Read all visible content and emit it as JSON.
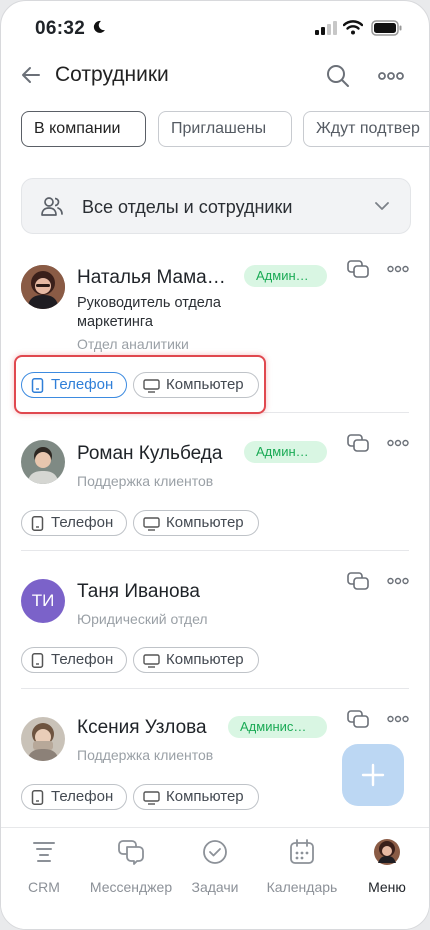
{
  "status": {
    "time": "06:32"
  },
  "header": {
    "title": "Сотрудники"
  },
  "filters": [
    {
      "label": "В компании",
      "active": true
    },
    {
      "label": "Приглашены",
      "active": false
    },
    {
      "label": "Ждут подтвер",
      "active": false
    }
  ],
  "department_select": {
    "label": "Все отделы и сотрудники"
  },
  "employees": [
    {
      "name": "Наталья Мама…",
      "badge": "Админ…",
      "subtitle": "Руководитель отдела маркетинга",
      "department": "Отдел аналитики",
      "phone": "Телефон",
      "computer": "Компьютер"
    },
    {
      "name": "Роман Кульбеда",
      "badge": "Админ…",
      "subtitle": "Поддержка клиентов",
      "phone": "Телефон",
      "computer": "Компьютер"
    },
    {
      "name": "Таня Иванова",
      "initials": "ТИ",
      "subtitle": "Юридический отдел",
      "phone": "Телефон",
      "computer": "Компьютер"
    },
    {
      "name": "Ксения Узлова",
      "badge": "Админис…",
      "subtitle": "Поддержка клиентов",
      "phone": "Телефон",
      "computer": "Компьютер"
    }
  ],
  "nav": [
    {
      "label": "CRM",
      "icon": "crm-icon"
    },
    {
      "label": "Мессенджер",
      "icon": "messenger-icon"
    },
    {
      "label": "Задачи",
      "icon": "tasks-icon"
    },
    {
      "label": "Календарь",
      "icon": "calendar-icon"
    },
    {
      "label": "Меню",
      "icon": "menu-avatar",
      "active": true
    }
  ],
  "colors": {
    "accent": "#2f7fd8",
    "admin_badge_bg": "#d9f6e3",
    "admin_badge_text": "#1aaa55",
    "highlight": "#e0484f",
    "fab": "#bcd7f3"
  }
}
